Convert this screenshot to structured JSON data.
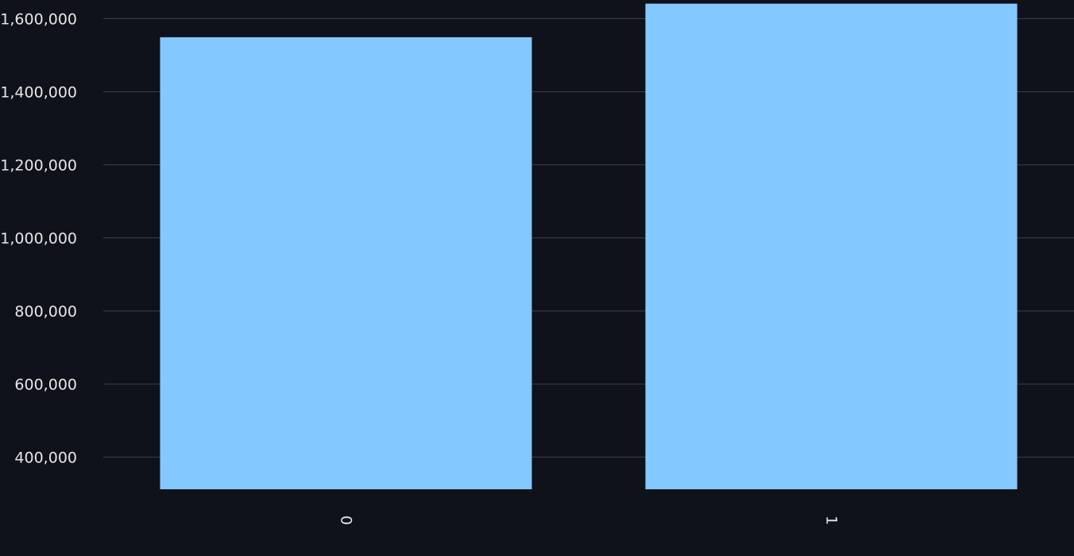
{
  "chart_data": {
    "type": "bar",
    "categories": [
      "0",
      "1"
    ],
    "values": [
      1548000,
      1640000
    ],
    "ylim": [
      310000,
      1650000
    ],
    "yticks": [
      400000,
      600000,
      800000,
      1000000,
      1200000,
      1400000,
      1600000
    ],
    "ytick_labels": [
      "400,000",
      "600,000",
      "800,000",
      "1,000,000",
      "1,200,000",
      "1,400,000",
      "1,600,000"
    ],
    "xlabel": "",
    "ylabel": "",
    "title": "",
    "grid": true,
    "legend": "none",
    "colors": {
      "background": "#0f121a",
      "bar": "#83c8ff",
      "grid": "#3c3f47",
      "text": "#e6e6e6"
    }
  }
}
